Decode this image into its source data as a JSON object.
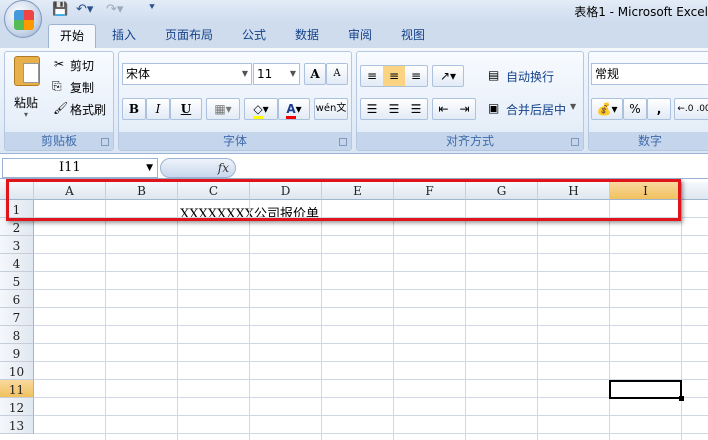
{
  "title_bar": {
    "doc_title": "表格1 - Microsoft Excel",
    "qat": {
      "save": "save-icon",
      "undo": "undo-icon",
      "redo": "redo-icon"
    }
  },
  "tabs": [
    {
      "label": "开始",
      "active": true
    },
    {
      "label": "插入"
    },
    {
      "label": "页面布局"
    },
    {
      "label": "公式"
    },
    {
      "label": "数据"
    },
    {
      "label": "审阅"
    },
    {
      "label": "视图"
    }
  ],
  "clipboard": {
    "paste": "粘贴",
    "cut": "剪切",
    "copy": "复制",
    "format_painter": "格式刷",
    "label": "剪贴板"
  },
  "font": {
    "name": "宋体",
    "size": "11",
    "grow": "A",
    "shrink": "A",
    "bold": "B",
    "italic": "I",
    "underline": "U",
    "phonetic": "wén文",
    "label": "字体",
    "fill_color": "#ffff00",
    "font_color": "#ff0000"
  },
  "alignment": {
    "wrap": "自动换行",
    "merge": "合并后居中",
    "label": "对齐方式"
  },
  "number": {
    "format": "常规",
    "percent": "%",
    "comma": ",",
    "increase_decimal": "←.0 .00",
    "label": "数字"
  },
  "formula_bar": {
    "name_box": "I11",
    "fx": "fx",
    "value": ""
  },
  "sheet": {
    "columns": [
      "A",
      "B",
      "C",
      "D",
      "E",
      "F",
      "G",
      "H",
      "I"
    ],
    "rows": [
      "1",
      "2",
      "3",
      "4",
      "5",
      "6",
      "7",
      "8",
      "9",
      "10",
      "11",
      "12",
      "13"
    ],
    "selected_cell": "I11",
    "cells": {
      "C1": "XXXXXXXX公司报价单"
    }
  }
}
